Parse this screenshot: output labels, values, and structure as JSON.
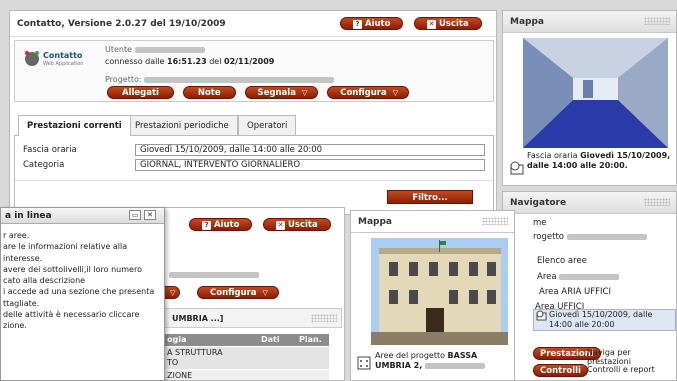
{
  "main": {
    "title": "Contatto, Versione 2.0.27 del 19/10/2009",
    "help": "Aiuto",
    "exit": "Uscita",
    "logo_name": "Contatto",
    "logo_sub": "Web Application",
    "user_label": "Utente",
    "connected_prefix": "connesso dalle",
    "connected_time": "16:51.23",
    "connected_mid": "del",
    "connected_date": "02/11/2009",
    "project_label": "Progetto:",
    "buttons": {
      "allegati": "Allegati",
      "note": "Note",
      "segnala": "Segnala",
      "configura": "Configura"
    },
    "tabs": [
      "Prestazioni correnti",
      "Prestazioni periodiche",
      "Operatori"
    ],
    "fascia_label": "Fascia oraria",
    "fascia_value": "Giovedì 15/10/2009, dalle 14:00 alle 20:00",
    "categoria_label": "Categoria",
    "categoria_value": "GIORNAL, INTERVENTO GIORNALIERO",
    "filter": "Filtro..."
  },
  "map1": {
    "title": "Mappa",
    "caption_prefix": "Fascia oraria",
    "caption_bold": "Giovedì 15/10/2009, dalle 14:00 alle 20:00."
  },
  "navigator": {
    "title": "Navigatore",
    "items": [
      "me",
      "rogetto",
      "Elenco aree",
      "Area",
      "Area ARIA UFFICI",
      "Area UFFICI",
      "Giovedì 15/10/2009, dalle 14:00 alle 20:00"
    ],
    "buttons": [
      {
        "label": "Prestazioni",
        "text": "Naviga per prestazioni"
      },
      {
        "label": "Controlli",
        "text": "Controlli e report"
      }
    ]
  },
  "help_popup": {
    "title": "a in linea",
    "lines": [
      "r aree.",
      "are le informazioni relative alla",
      "interesse.",
      "avere dei sottolivelli,il loro numero",
      "cato alla descrizione",
      "i accede ad una sezione che presenta",
      "ttagliate.",
      "delle attività è necessario cliccare",
      "zione."
    ]
  },
  "second": {
    "help": "Aiuto",
    "exit": "Uscita",
    "configura": "Configura",
    "section_title": "UMBRIA ...]",
    "table_headers": [
      "ogia",
      "Dati",
      "Pian."
    ],
    "table_rows": [
      "A STRUTTURA",
      "TO",
      "ZIONE"
    ]
  },
  "map2": {
    "title": "Mappa",
    "caption_prefix": "Aree del progetto",
    "caption_bold": "BASSA UMBRIA 2,"
  }
}
